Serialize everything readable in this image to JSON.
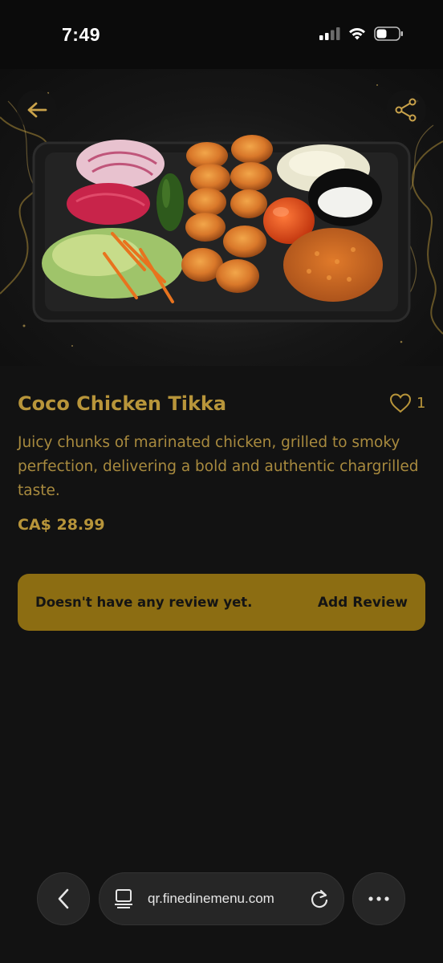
{
  "status": {
    "time": "7:49"
  },
  "hero": {
    "image_alt": "Chicken tikka platter"
  },
  "item": {
    "title": "Coco Chicken Tikka",
    "likes": "1",
    "description": "Juicy chunks of marinated chicken, grilled to smoky perfection, delivering a bold and authentic chargrilled taste.",
    "price": "CA$ 28.99"
  },
  "review": {
    "message": "Doesn't have any review yet.",
    "action": "Add Review"
  },
  "browser": {
    "url": "qr.finedinemenu.com"
  },
  "colors": {
    "accent": "#b8953a",
    "review_bar": "#8c6d12",
    "background": "#121212"
  },
  "icons": {
    "back": "arrow-left-icon",
    "share": "share-icon",
    "like": "heart-icon",
    "nav_back": "chevron-left-icon",
    "reader": "reader-icon",
    "reload": "reload-icon",
    "more": "more-icon"
  }
}
